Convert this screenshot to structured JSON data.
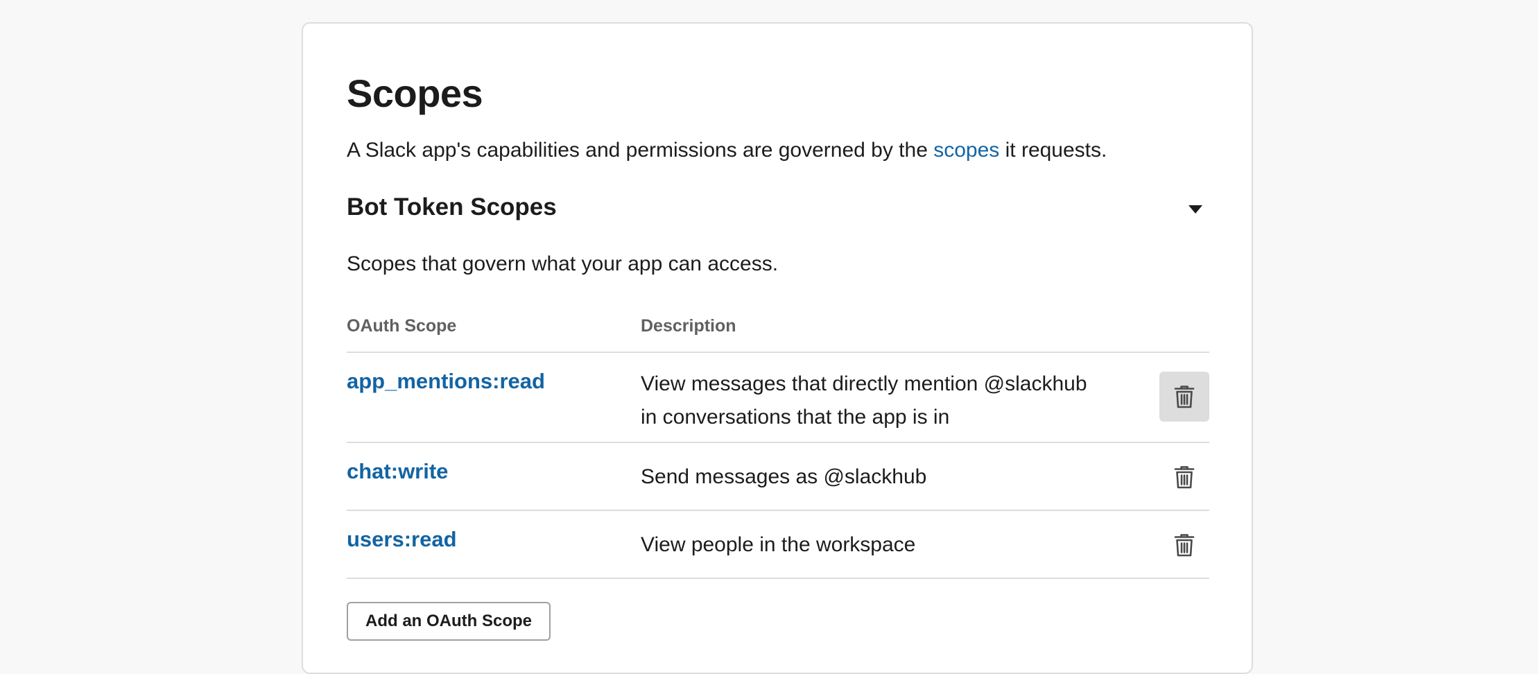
{
  "page": {
    "title": "Scopes",
    "intro_before": "A Slack app's capabilities and permissions are governed by the ",
    "intro_link": "scopes",
    "intro_after": " it requests."
  },
  "section": {
    "title": "Bot Token Scopes",
    "subtitle": "Scopes that govern what your app can access.",
    "toggle_icon": "caret-down-icon"
  },
  "table": {
    "headers": {
      "scope": "OAuth Scope",
      "description": "Description"
    },
    "rows": [
      {
        "scope": "app_mentions:read",
        "description": "View messages that directly mention @slackhub in conversations that the app is in",
        "action_icon": "trash-icon"
      },
      {
        "scope": "chat:write",
        "description": "Send messages as @slackhub",
        "action_icon": "trash-icon"
      },
      {
        "scope": "users:read",
        "description": "View people in the workspace",
        "action_icon": "trash-icon"
      }
    ]
  },
  "actions": {
    "add_scope_label": "Add an OAuth Scope"
  },
  "colors": {
    "link": "#1264a3",
    "text": "#1d1c1d",
    "muted": "#616061",
    "border": "#dddddd",
    "background": "#f8f8f8"
  }
}
